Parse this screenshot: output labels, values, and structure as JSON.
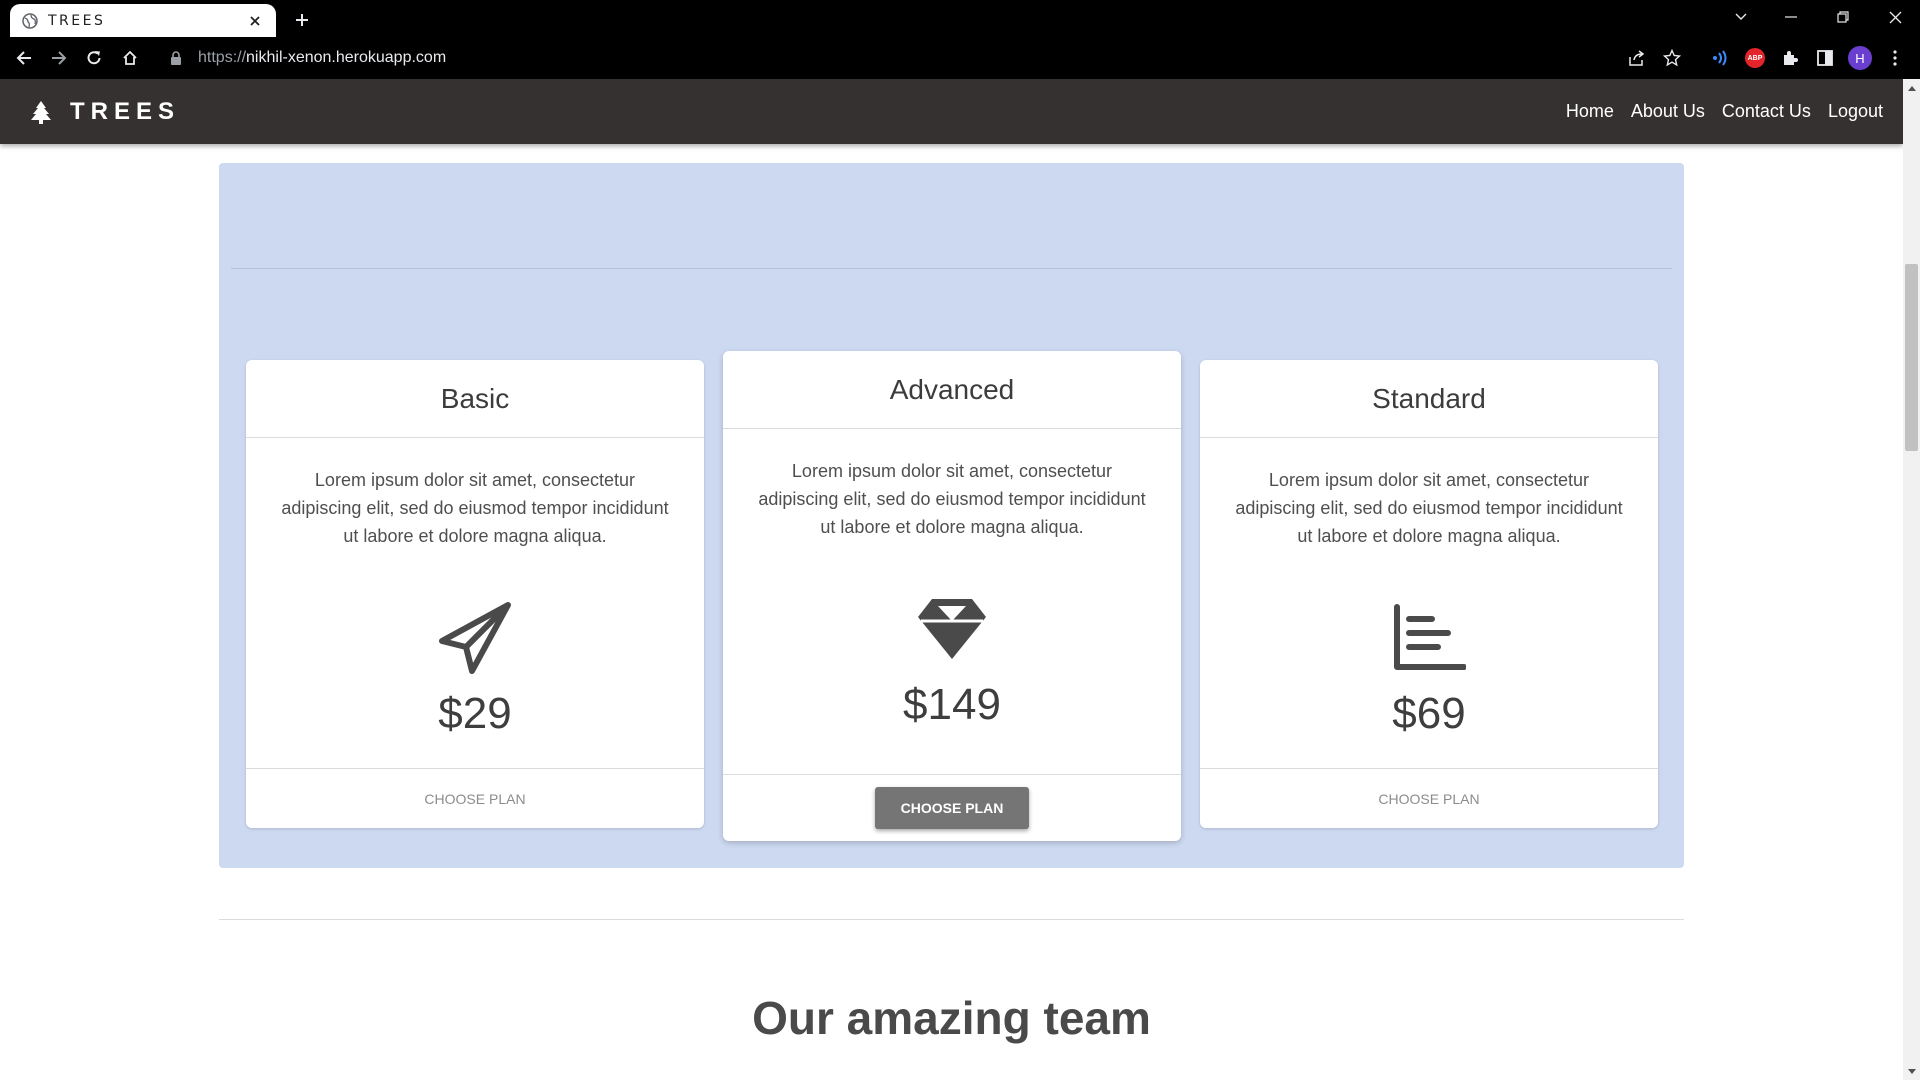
{
  "browser": {
    "tab_title": "TREES",
    "url_scheme": "https://",
    "url_host": "nikhil-xenon.herokuapp.com",
    "profile_initial": "H",
    "abp_label": "ABP"
  },
  "site": {
    "brand": "TREES",
    "nav": {
      "home": "Home",
      "about": "About Us",
      "contact": "Contact Us",
      "logout": "Logout"
    }
  },
  "pricing": {
    "plans": [
      {
        "name": "Basic",
        "description": "Lorem ipsum dolor sit amet, consectetur adipiscing elit, sed do eiusmod tempor incididunt ut labore et dolore magna aliqua.",
        "icon": "paper-plane-icon",
        "price": "$29",
        "cta": "CHOOSE PLAN"
      },
      {
        "name": "Advanced",
        "description": "Lorem ipsum dolor sit amet, consectetur adipiscing elit, sed do eiusmod tempor incididunt ut labore et dolore magna aliqua.",
        "icon": "diamond-icon",
        "price": "$149",
        "cta": "CHOOSE PLAN"
      },
      {
        "name": "Standard",
        "description": "Lorem ipsum dolor sit amet, consectetur adipiscing elit, sed do eiusmod tempor incididunt ut labore et dolore magna aliqua.",
        "icon": "bar-chart-icon",
        "price": "$69",
        "cta": "CHOOSE PLAN"
      }
    ]
  },
  "team": {
    "title": "Our amazing team"
  },
  "colors": {
    "navbar": "#353130",
    "pricing_bg": "#ccd9f1",
    "featured_button": "#757575"
  }
}
